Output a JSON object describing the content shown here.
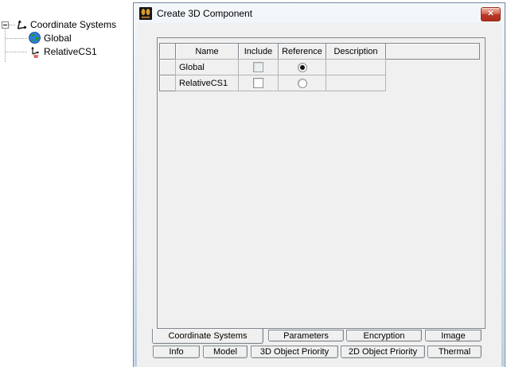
{
  "window": {
    "title": "Create 3D Component",
    "close": "✕"
  },
  "tree": {
    "root": {
      "label": "Coordinate Systems",
      "icon": "axes-icon",
      "expanded": true
    },
    "children": [
      {
        "label": "Global",
        "icon": "globe-icon"
      },
      {
        "label": "RelativeCS1",
        "icon": "relative-cs-icon"
      }
    ]
  },
  "grid": {
    "headers": {
      "name": "Name",
      "include": "Include",
      "reference": "Reference",
      "description": "Description"
    },
    "rows": [
      {
        "name": "Global",
        "include": false,
        "reference": true,
        "description": ""
      },
      {
        "name": "RelativeCS1",
        "include": false,
        "reference": false,
        "description": ""
      }
    ]
  },
  "tabs": {
    "row1": [
      {
        "label": "Coordinate Systems",
        "active": true
      },
      {
        "label": "Parameters",
        "active": false
      },
      {
        "label": "Encryption",
        "active": false
      },
      {
        "label": "Image",
        "active": false
      }
    ],
    "row2": [
      {
        "label": "Info",
        "active": false
      },
      {
        "label": "Model",
        "active": false
      },
      {
        "label": "3D Object Priority",
        "active": false
      },
      {
        "label": "2D Object Priority",
        "active": false
      },
      {
        "label": "Thermal",
        "active": false
      }
    ]
  },
  "colors": {
    "dialog_border": "#70859c",
    "frame_blue": "#cfdded",
    "client_bg": "#f0f0f0",
    "grid_border": "#828790",
    "close_red": "#c0392b",
    "titlebar": "#eef2f7"
  }
}
